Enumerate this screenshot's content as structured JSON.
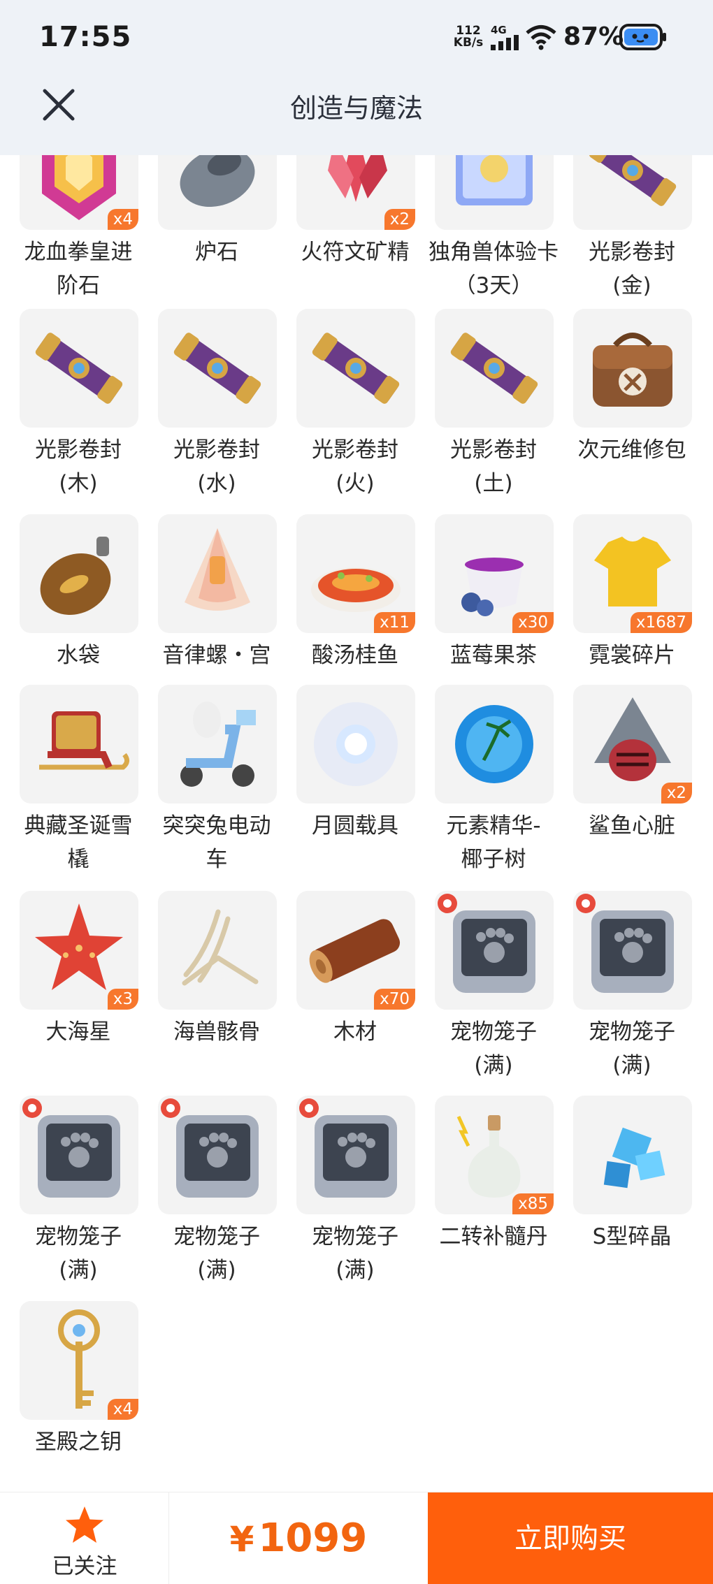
{
  "status_bar": {
    "time": "17:55",
    "net_speed_value": "112",
    "net_speed_unit": "KB/s",
    "network": "4G",
    "battery": "87%"
  },
  "header": {
    "title": "创造与魔法"
  },
  "items": [
    {
      "name": "龙血拳皇进阶石",
      "qty": "x4",
      "icon": "gem-icon"
    },
    {
      "name": "炉石",
      "qty": "",
      "icon": "stone-icon"
    },
    {
      "name": "火符文矿精",
      "qty": "x2",
      "icon": "crystal-icon"
    },
    {
      "name": "独角兽体验卡（3天）",
      "qty": "",
      "icon": "card-icon"
    },
    {
      "name": "光影卷封(金)",
      "qty": "",
      "icon": "scroll-icon"
    },
    {
      "name": "光影卷封(木)",
      "qty": "",
      "icon": "scroll-icon"
    },
    {
      "name": "光影卷封(水)",
      "qty": "",
      "icon": "scroll-icon"
    },
    {
      "name": "光影卷封(火)",
      "qty": "",
      "icon": "scroll-icon"
    },
    {
      "name": "光影卷封(土)",
      "qty": "",
      "icon": "scroll-icon"
    },
    {
      "name": "次元维修包",
      "qty": "",
      "icon": "repair-bag-icon"
    },
    {
      "name": "水袋",
      "qty": "",
      "icon": "water-bag-icon"
    },
    {
      "name": "音律螺・宫",
      "qty": "",
      "icon": "conch-icon"
    },
    {
      "name": "酸汤桂鱼",
      "qty": "x11",
      "icon": "fish-dish-icon"
    },
    {
      "name": "蓝莓果茶",
      "qty": "x30",
      "icon": "tea-icon"
    },
    {
      "name": "霓裳碎片",
      "qty": "x1687",
      "icon": "shirt-icon"
    },
    {
      "name": "典藏圣诞雪橇",
      "qty": "",
      "icon": "sled-icon"
    },
    {
      "name": "突突兔电动车",
      "qty": "",
      "icon": "scooter-icon"
    },
    {
      "name": "月圆载具",
      "qty": "",
      "icon": "moon-icon"
    },
    {
      "name": "元素精华-椰子树",
      "qty": "",
      "icon": "orb-icon"
    },
    {
      "name": "鲨鱼心脏",
      "qty": "x2",
      "icon": "shark-heart-icon"
    },
    {
      "name": "大海星",
      "qty": "x3",
      "icon": "starfish-icon"
    },
    {
      "name": "海兽骸骨",
      "qty": "",
      "icon": "bones-icon"
    },
    {
      "name": "木材",
      "qty": "x70",
      "icon": "log-icon"
    },
    {
      "name": "宠物笼子(满)",
      "qty": "",
      "icon": "pet-cage-icon"
    },
    {
      "name": "宠物笼子(满)",
      "qty": "",
      "icon": "pet-cage-icon"
    },
    {
      "name": "宠物笼子(满)",
      "qty": "",
      "icon": "pet-cage-icon"
    },
    {
      "name": "宠物笼子(满)",
      "qty": "",
      "icon": "pet-cage-icon"
    },
    {
      "name": "宠物笼子(满)",
      "qty": "",
      "icon": "pet-cage-icon"
    },
    {
      "name": "二转补髓丹",
      "qty": "x85",
      "icon": "bottle-icon"
    },
    {
      "name": "S型碎晶",
      "qty": "",
      "icon": "cubes-icon"
    },
    {
      "name": "圣殿之钥",
      "qty": "x4",
      "icon": "key-icon"
    }
  ],
  "bottom_bar": {
    "follow_label": "已关注",
    "currency": "¥",
    "price": "1099",
    "buy_label": "立即购买"
  },
  "colors": {
    "accent": "#ff5f0c",
    "price": "#f26510",
    "badge": "#f7772d",
    "header_bg": "#eef2f7"
  }
}
